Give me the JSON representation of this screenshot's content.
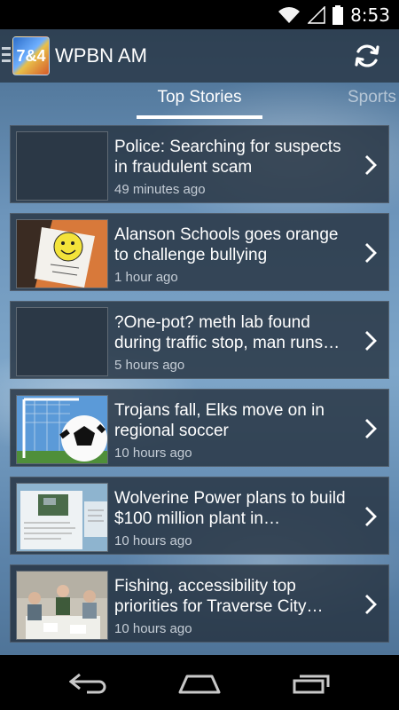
{
  "status_bar": {
    "time": "8:53",
    "icons": [
      "wifi-icon",
      "signal-icon",
      "battery-icon"
    ]
  },
  "action_bar": {
    "app_title": "WPBN AM",
    "logo_text": "7&4",
    "refresh_icon": "refresh-icon"
  },
  "tabs": [
    {
      "label": "Top Stories",
      "selected": true
    },
    {
      "label": "Sports",
      "selected": false
    }
  ],
  "stories": [
    {
      "title": "Police: Searching for suspects in fraudulent scam",
      "time": "49 minutes ago",
      "thumb": "empty"
    },
    {
      "title": "Alanson Schools goes orange to challenge bullying",
      "time": "1 hour ago",
      "thumb": "orange-drawing"
    },
    {
      "title": "?One-pot? meth lab found during traffic stop, man runs…",
      "time": "5 hours ago",
      "thumb": "empty"
    },
    {
      "title": "Trojans fall, Elks move on in regional soccer",
      "time": "10 hours ago",
      "thumb": "soccer-ball"
    },
    {
      "title": "Wolverine Power plans to build $100 million plant in…",
      "time": "10 hours ago",
      "thumb": "document-map"
    },
    {
      "title": "Fishing, accessibility top priorities for Traverse City…",
      "time": "10 hours ago",
      "thumb": "meeting-people"
    }
  ],
  "nav_bar": {
    "icons": [
      "back-icon",
      "home-icon",
      "recent-apps-icon"
    ]
  }
}
